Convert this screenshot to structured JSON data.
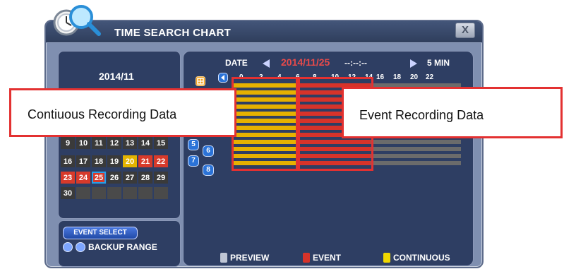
{
  "window": {
    "title": "TIME SEARCH CHART",
    "close_label": "X"
  },
  "calendar": {
    "month": "2014/11",
    "rows": [
      [
        "9",
        "10",
        "11",
        "12",
        "13",
        "14",
        "15"
      ],
      [
        "16",
        "17",
        "18",
        "19",
        "20",
        "21",
        "22"
      ],
      [
        "23",
        "24",
        "25",
        "26",
        "27",
        "28",
        "29"
      ],
      [
        "30",
        "",
        "",
        "",
        "",
        "",
        ""
      ]
    ],
    "cell_styles": [
      [
        "dark",
        "dark",
        "dark",
        "dark",
        "dark",
        "dark",
        "dark"
      ],
      [
        "dark",
        "dark",
        "dark",
        "dark",
        "yellow",
        "red",
        "red"
      ],
      [
        "red",
        "red",
        "sel",
        "dark",
        "dark",
        "dark",
        "dark"
      ],
      [
        "dark",
        "empty",
        "empty",
        "empty",
        "empty",
        "empty",
        "empty"
      ]
    ]
  },
  "controls": {
    "event_select_label": "EVENT SELECT",
    "backup_range_label": "BACKUP RANGE"
  },
  "chart": {
    "date_label": "DATE",
    "date_value": "2014/11/25",
    "time_value": "--:--:--",
    "interval_label": "5 MIN",
    "hour_labels": [
      "0",
      "2",
      "4",
      "6",
      "8",
      "10",
      "12",
      "14",
      "16",
      "18",
      "20",
      "22"
    ],
    "channels": [
      "5",
      "6",
      "7",
      "8"
    ]
  },
  "legend": {
    "preview_label": "PREVIEW",
    "event_label": "EVENT",
    "continuous_label": "CONTINUOUS"
  },
  "annotations": {
    "continuous": "Contiuous Recording Data",
    "event": "Event Recording Data"
  },
  "colors": {
    "continuous": "#e6b100",
    "event": "#d7332a",
    "empty": "#6b6b6b",
    "annotation_border": "#e33131"
  }
}
